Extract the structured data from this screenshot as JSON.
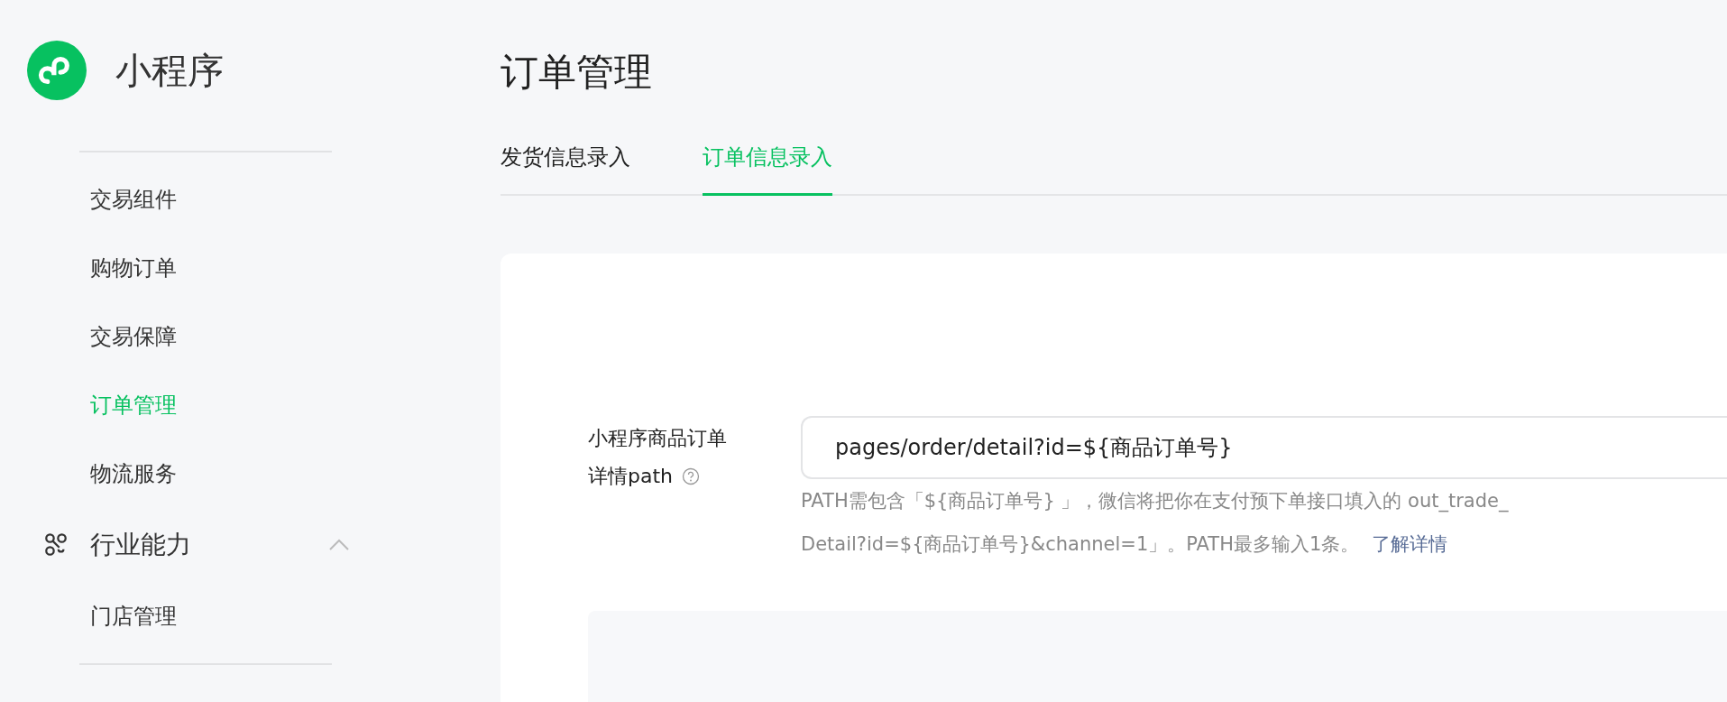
{
  "app": {
    "name": "小程序"
  },
  "sidebar": {
    "items": [
      {
        "label": "交易组件",
        "selected": false
      },
      {
        "label": "购物订单",
        "selected": false
      },
      {
        "label": "交易保障",
        "selected": false
      },
      {
        "label": "订单管理",
        "selected": true
      },
      {
        "label": "物流服务",
        "selected": false
      }
    ],
    "groups": [
      {
        "label": "行业能力",
        "expanded": true,
        "children": [
          {
            "label": "门店管理",
            "selected": false
          }
        ]
      }
    ]
  },
  "page": {
    "title": "订单管理"
  },
  "tabs": [
    {
      "label": "发货信息录入",
      "selected": false
    },
    {
      "label": "订单信息录入",
      "selected": true
    }
  ],
  "form": {
    "label_lines": [
      "小程序商品订单",
      "详情path"
    ],
    "value": "pages/order/detail?id=${商品订单号}",
    "help_lines": [
      "PATH需包含「${商品订单号} 」，微信将把你在支付预下单接口填入的 out_trade_",
      "Detail?id=${商品订单号}&channel=1」。PATH最多输入1条。"
    ],
    "help_link": "了解详情"
  }
}
